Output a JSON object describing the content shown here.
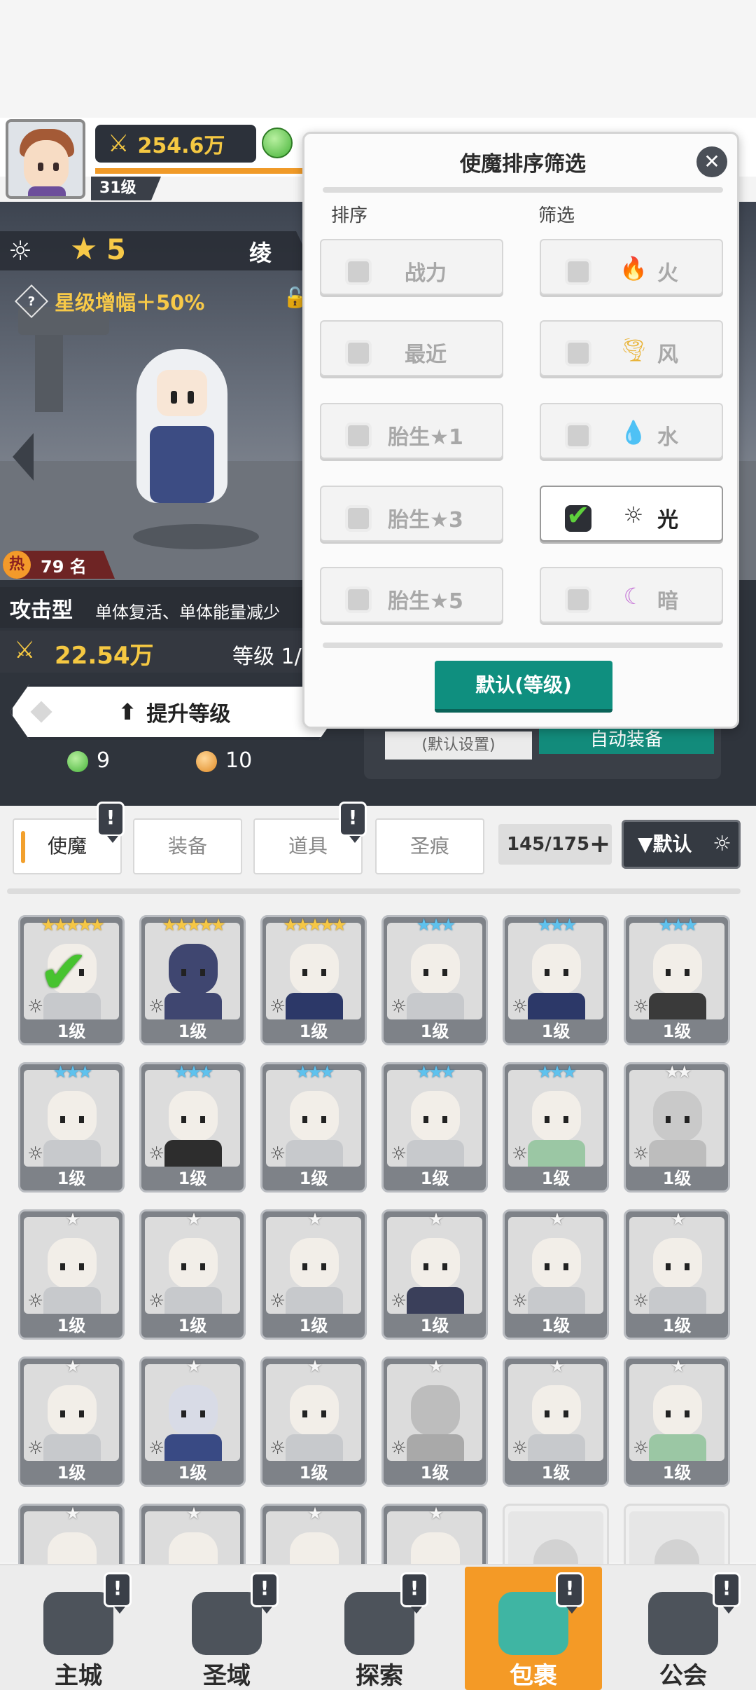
{
  "header": {
    "power": "254.6万",
    "player_level": "31级"
  },
  "hero": {
    "star_count": "5",
    "name": "绫",
    "boost_label": "星级增幅＋50%",
    "hot_rank": "79 名",
    "hot_icon": "热",
    "type_label": "攻击型",
    "type_desc": "单体复活、单体能量减少",
    "power": "22.54万",
    "level_text": "等级 1/",
    "upgrade_label": "提升等级",
    "res_green": "9",
    "res_orange": "10",
    "behind_default": "(默认设置)",
    "behind_auto": "自动装备"
  },
  "modal": {
    "title": "使魔排序筛选",
    "sort_header": "排序",
    "filter_header": "筛选",
    "sort_options": [
      "战力",
      "最近",
      "胎生★1",
      "胎生★3",
      "胎生★5"
    ],
    "filter_options": [
      {
        "label": "火",
        "icon": "fire-icon",
        "checked": false
      },
      {
        "label": "风",
        "icon": "wind-icon",
        "checked": false
      },
      {
        "label": "水",
        "icon": "water-icon",
        "checked": false
      },
      {
        "label": "光",
        "icon": "light-icon",
        "checked": true
      },
      {
        "label": "暗",
        "icon": "dark-icon",
        "checked": false
      }
    ],
    "default_button": "默认(等级)"
  },
  "inventory": {
    "tabs": [
      "使魔",
      "装备",
      "道具",
      "圣痕"
    ],
    "count": "145/175",
    "sort_button": "▼默认",
    "card_level": "1级"
  },
  "nav": [
    "主城",
    "圣域",
    "探索",
    "包裹",
    "公会"
  ],
  "colors": {
    "accent_teal": "#0f8f7f",
    "accent_orange": "#f49a26",
    "gold": "#f5c842"
  }
}
